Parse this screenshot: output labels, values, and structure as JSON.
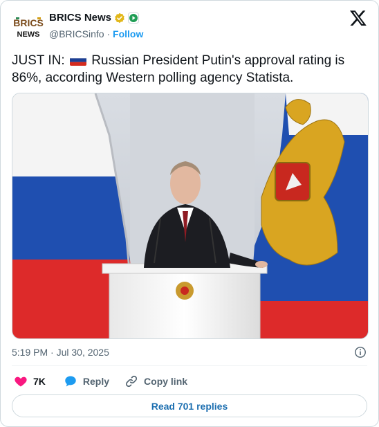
{
  "author": {
    "display_name": "BRICS News",
    "handle": "@BRICSinfo",
    "separator": "·",
    "follow_label": "Follow",
    "avatar_text_top": "BRICS",
    "avatar_text_bottom": "NEWS"
  },
  "tweet": {
    "text_prefix": "JUST IN:",
    "text_body": "Russian President Putin's approval rating is 86%, according Western polling agency Statista.",
    "flag_icon": "russia-flag-icon"
  },
  "meta": {
    "timestamp": "5:19 PM · Jul 30, 2025"
  },
  "actions": {
    "likes": "7K",
    "reply_label": "Reply",
    "copy_link_label": "Copy link"
  },
  "footer": {
    "read_replies_label": "Read 701 replies"
  },
  "colors": {
    "accent": "#1d9bf0",
    "like": "#f91880",
    "text": "#0f1419",
    "muted": "#536471"
  }
}
